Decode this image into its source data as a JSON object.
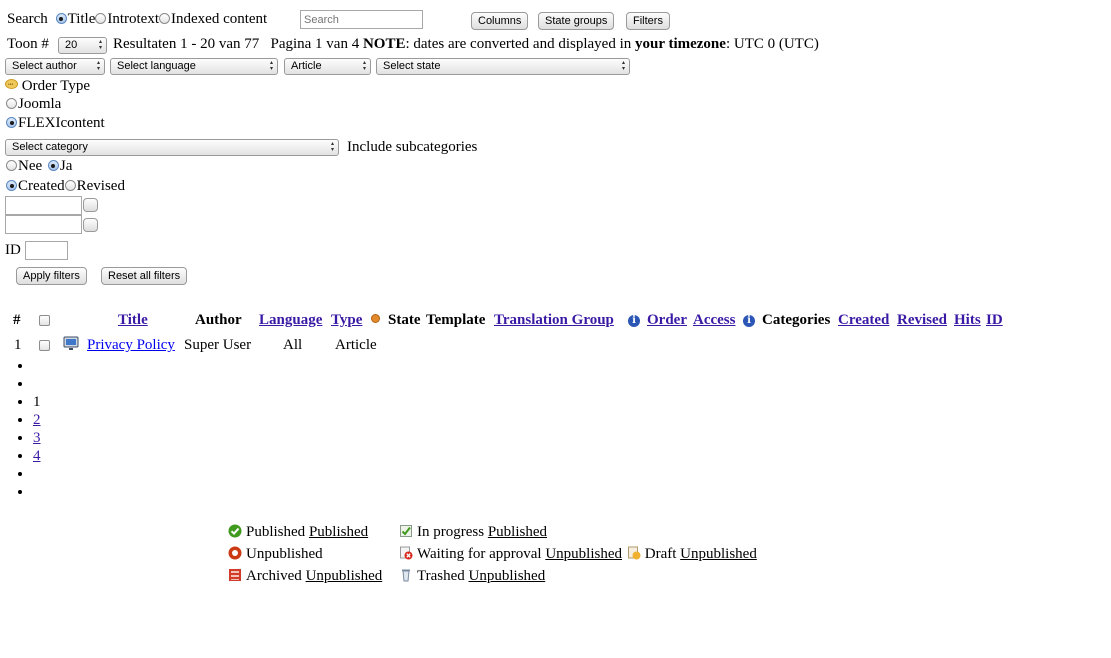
{
  "search": {
    "label": "Search",
    "options": [
      "Title",
      "Introtext",
      "Indexed content"
    ],
    "selected": "Title",
    "placeholder": "Search",
    "value": ""
  },
  "toolbar": {
    "columns_label": "Columns",
    "state_groups_label": "State groups",
    "filters_label": "Filters"
  },
  "paging": {
    "show_label": "Toon #",
    "per_page": "20",
    "results_text": "Resultaten 1 - 20 van 77",
    "page_text": "Pagina 1 van 4",
    "note_label": "NOTE",
    "note_text": ": dates are converted and displayed in",
    "timezone_label": "your timezone",
    "timezone_value": ": UTC 0 (UTC)"
  },
  "filters": {
    "author": "Select author",
    "language": "Select language",
    "type": "Article",
    "state": "Select state",
    "order_type_label": "Order Type",
    "order_options": [
      "Joomla",
      "FLEXIcontent"
    ],
    "order_selected": "FLEXIcontent",
    "category": "Select category",
    "include_subcats_label": "Include subcategories",
    "subcat_options": [
      "Nee",
      "Ja"
    ],
    "subcat_selected": "Ja",
    "date_options": [
      "Created",
      "Revised"
    ],
    "date_selected": "Created",
    "id_label": "ID",
    "apply_label": "Apply filters",
    "reset_label": "Reset all filters"
  },
  "table": {
    "headers": {
      "num": "#",
      "title": "Title",
      "author": "Author",
      "language": "Language",
      "type": "Type",
      "state": "State",
      "template": "Template",
      "translation_group": "Translation Group",
      "order": "Order",
      "access": "Access",
      "categories": "Categories",
      "created": "Created",
      "revised": "Revised",
      "hits": "Hits",
      "id": "ID"
    },
    "rows": [
      {
        "num": "1",
        "title": "Privacy Policy",
        "author": "Super User",
        "language": "All",
        "type": "Article"
      }
    ]
  },
  "pagination": [
    "",
    "",
    "1",
    "2",
    "3",
    "4",
    "",
    ""
  ],
  "legend": {
    "published": "Published",
    "published_link": "Published",
    "in_progress": "In progress",
    "in_progress_link": "Published",
    "unpublished": "Unpublished",
    "waiting": "Waiting for approval",
    "waiting_link": "Unpublished",
    "draft": "Draft",
    "draft_link": "Unpublished",
    "archived": "Archived",
    "archived_link": "Unpublished",
    "trashed": "Trashed",
    "trashed_link": "Unpublished"
  },
  "colors": {
    "link": "#3a1aa5",
    "published": "#3f9a1e",
    "unpublished": "#cc3a14",
    "archived": "#d23a2a"
  }
}
